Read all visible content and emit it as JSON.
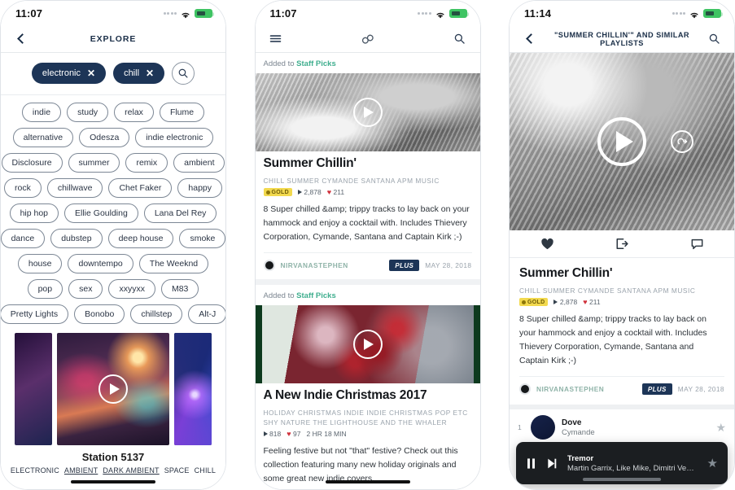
{
  "colors": {
    "navy": "#1d3557",
    "teal": "#3fae8e",
    "gold": "#f2d94e",
    "heart": "#d0323c",
    "battery_green": "#3fc463"
  },
  "phone1": {
    "status": {
      "time": "11:07",
      "wifi_icon": "wifi-icon",
      "battery_icon": "battery-icon",
      "signal_icon": "signal-dots-icon"
    },
    "nav": {
      "back_icon": "back-chevron-icon",
      "title": "EXPLORE"
    },
    "selected_chips": [
      {
        "label": "electronic",
        "remove_icon": "close-x-icon"
      },
      {
        "label": "chill",
        "remove_icon": "close-x-icon"
      }
    ],
    "search_icon": "search-icon",
    "tag_rows": [
      [
        "indie",
        "study",
        "relax",
        "Flume"
      ],
      [
        "alternative",
        "Odesza",
        "indie electronic"
      ],
      [
        "Disclosure",
        "summer",
        "remix",
        "ambient"
      ],
      [
        "rock",
        "chillwave",
        "Chet Faker",
        "happy"
      ],
      [
        "hip hop",
        "Ellie Goulding",
        "Lana Del Rey"
      ],
      [
        "dance",
        "dubstep",
        "deep house",
        "smoke"
      ],
      [
        "house",
        "downtempo",
        "The Weeknd"
      ],
      [
        "pop",
        "sex",
        "xxyyxx",
        "M83"
      ],
      [
        "Pretty Lights",
        "Bonobo",
        "chillstep",
        "Alt-J"
      ]
    ],
    "station": {
      "play_icon": "play-icon",
      "name": "Station 5137",
      "tags": [
        {
          "label": "ELECTRONIC",
          "underline": false
        },
        {
          "label": "AMBIENT",
          "underline": true
        },
        {
          "label": "DARK AMBIENT",
          "underline": true
        },
        {
          "label": "SPACE",
          "underline": false
        },
        {
          "label": "CHILL",
          "underline": false
        }
      ]
    }
  },
  "phone2": {
    "status": {
      "time": "11:07"
    },
    "nav": {
      "menu_icon": "hamburger-menu-icon",
      "logo_icon": "infinity-logo-icon",
      "search_icon": "search-icon"
    },
    "cards": [
      {
        "added_prefix": "Added to ",
        "added_target": "Staff Picks",
        "play_icon": "play-icon",
        "title": "Summer Chillin'",
        "tags": "CHILL   SUMMER   CYMANDE   SANTANA   APM MUSIC",
        "gold_badge": "GOLD",
        "plays": "2,878",
        "likes": "211",
        "duration": "",
        "description": "8 Super chilled &amp; trippy tracks to lay back on your hammock and enjoy a cocktail with. Includes Thievery Corporation, Cymande, Santana and Captain Kirk ;-)",
        "author": "NIRVANASTEPHEN",
        "plus_badge": "PLUS",
        "date": "MAY 28, 2018"
      },
      {
        "added_prefix": "Added to ",
        "added_target": "Staff Picks",
        "play_icon": "play-icon",
        "title": "A New Indie Christmas 2017",
        "tags": "HOLIDAY   CHRISTMAS   INDIE   INDIE CHRISTMAS   POP ETC   SHY NATURE   THE LIGHTHOUSE AND THE WHALER",
        "gold_badge": "",
        "plays": "818",
        "likes": "97",
        "duration": "2 HR 18 MIN",
        "description": "Feeling festive but not \"that\" festive? Check out this collection featuring many new holiday originals and some great new indie covers.",
        "author": "",
        "plus_badge": "",
        "date": ""
      }
    ]
  },
  "phone3": {
    "status": {
      "time": "11:14"
    },
    "nav": {
      "back_icon": "back-chevron-icon",
      "title": "\"SUMMER CHILLIN'\" AND SIMILAR PLAYLISTS",
      "search_icon": "search-icon"
    },
    "hero": {
      "play_icon": "play-icon",
      "shuffle_icon": "shuffle-icon"
    },
    "actions": [
      {
        "name": "like-heart-icon",
        "label": ""
      },
      {
        "name": "share-icon",
        "label": ""
      },
      {
        "name": "comment-icon",
        "label": ""
      }
    ],
    "playlist": {
      "title": "Summer Chillin'",
      "tags": "CHILL   SUMMER   CYMANDE   SANTANA   APM MUSIC",
      "gold_badge": "GOLD",
      "plays": "2,878",
      "likes": "211",
      "description": "8 Super chilled &amp; trippy tracks to lay back on your hammock and enjoy a cocktail with. Includes Thievery Corporation, Cymande, Santana and Captain Kirk ;-)",
      "author": "NIRVANASTEPHEN",
      "plus_badge": "PLUS",
      "date": "MAY 28, 2018"
    },
    "tracks": [
      {
        "num": "1",
        "title": "Dove",
        "artist": "Cymande",
        "star_icon": "star-icon"
      }
    ],
    "player": {
      "pause_icon": "pause-icon",
      "next_icon": "next-track-icon",
      "title": "Tremor",
      "artist": "Martin Garrix, Like Mike, Dimitri Vegas",
      "star_icon": "star-icon"
    }
  }
}
